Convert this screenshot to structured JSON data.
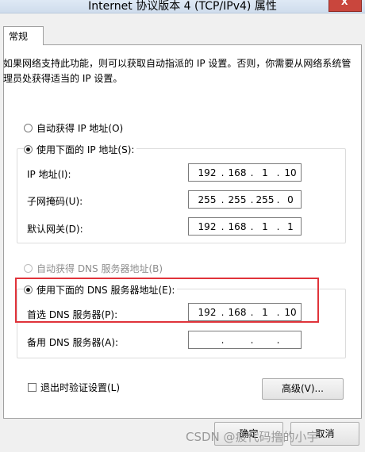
{
  "window": {
    "title": "Internet 协议版本 4 (TCP/IPv4) 属性",
    "close_label": "X"
  },
  "tab": {
    "label": "常规"
  },
  "description": "如果网络支持此功能，则可以获取自动指派的 IP 设置。否则，你需要从网络系统管理员处获得适当的 IP 设置。",
  "ip_options": {
    "auto_label": "自动获得 IP 地址(O)",
    "manual_label": "使用下面的 IP 地址(S):",
    "selected": "manual"
  },
  "ip_fields": [
    {
      "label": "IP 地址(I):",
      "octets": [
        "192",
        "168",
        "1",
        "10"
      ]
    },
    {
      "label": "子网掩码(U):",
      "octets": [
        "255",
        "255",
        "255",
        "0"
      ]
    },
    {
      "label": "默认网关(D):",
      "octets": [
        "192",
        "168",
        "1",
        "1"
      ]
    }
  ],
  "dns_options": {
    "auto_label": "自动获得 DNS 服务器地址(B)",
    "manual_label": "使用下面的 DNS 服务器地址(E):",
    "selected": "manual"
  },
  "dns_fields": [
    {
      "label": "首选 DNS 服务器(P):",
      "octets": [
        "192",
        "168",
        "1",
        "10"
      ]
    },
    {
      "label": "备用 DNS 服务器(A):",
      "octets": [
        "",
        "",
        "",
        ""
      ]
    }
  ],
  "validate_on_exit": {
    "label": "退出时验证设置(L)",
    "checked": false
  },
  "buttons": {
    "advanced": "高级(V)...",
    "ok": "确定",
    "cancel": "取消"
  },
  "watermark": "CSDN @疲代码撸的小宇",
  "colors": {
    "highlight_border": "#e0333a"
  }
}
